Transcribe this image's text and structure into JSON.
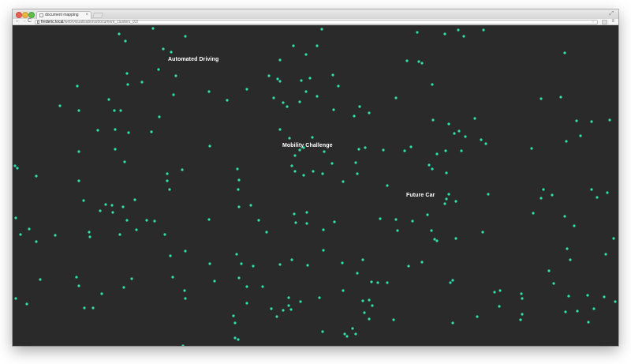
{
  "browser": {
    "tab_title": "document mapping",
    "tab_close": "×",
    "url_host": "frederic.local",
    "url_path": "/web/visualisations/document_clusters_02/",
    "nav": {
      "back": "←",
      "forward": "→",
      "reload": "C"
    },
    "star": "☆",
    "menu": "≡",
    "fullscreen": "⤢"
  },
  "clusters": [
    {
      "label": "Automated Driving"
    },
    {
      "label": "Mobility Challenge"
    },
    {
      "label": "Future Car"
    }
  ],
  "colors": {
    "background": "#2a2a2a",
    "point": "#2fe0a8",
    "label": "#ffffff"
  }
}
